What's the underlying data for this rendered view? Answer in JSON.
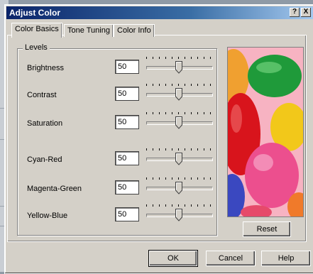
{
  "window": {
    "title": "Adjust Color",
    "help_button": "?",
    "close_button": "X"
  },
  "tabs": [
    {
      "label": "Color Basics",
      "active": true
    },
    {
      "label": "Tone Tuning",
      "active": false
    },
    {
      "label": "Color Info",
      "active": false
    }
  ],
  "levels": {
    "group_label": "Levels",
    "controls": [
      {
        "label": "Brightness",
        "value": "50"
      },
      {
        "label": "Contrast",
        "value": "50"
      },
      {
        "label": "Saturation",
        "value": "50"
      },
      {
        "label": "Cyan-Red",
        "value": "50"
      },
      {
        "label": "Magenta-Green",
        "value": "50"
      },
      {
        "label": "Yellow-Blue",
        "value": "50"
      }
    ]
  },
  "preview": {
    "reset_label": "Reset"
  },
  "footer": {
    "ok_label": "OK",
    "cancel_label": "Cancel",
    "help_label": "Help"
  },
  "colors": {
    "title_start": "#0a246a",
    "title_end": "#a6caf0",
    "dialog_face": "#d4d0c8"
  }
}
